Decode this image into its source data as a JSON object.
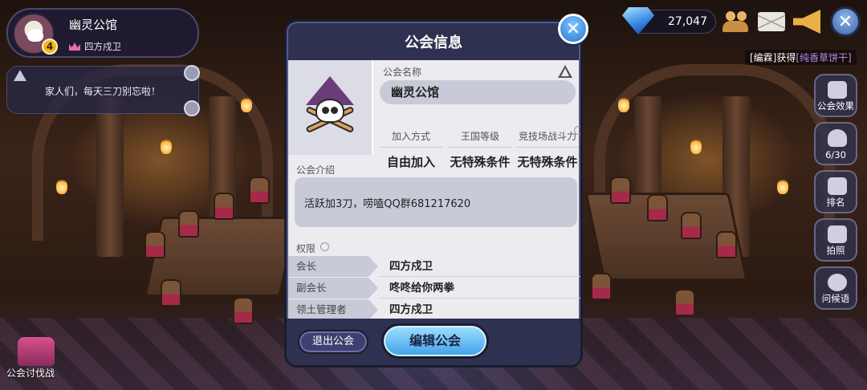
{
  "guild_card": {
    "name": "幽灵公馆",
    "level": "4",
    "leader": "四方戍卫"
  },
  "notice": {
    "text": "家人们，每天三刀别忘啦！"
  },
  "hud": {
    "gems": "27,047",
    "gain_notice": {
      "prefix": "[编霖]获得",
      "item": "[纯香草饼干]"
    }
  },
  "side_buttons": [
    {
      "label": "公会效果",
      "icon": "house-arrow-icon"
    },
    {
      "label": "6/30",
      "icon": "person-icon"
    },
    {
      "label": "排名",
      "icon": "building-icon"
    },
    {
      "label": "拍照",
      "icon": "camera-icon"
    },
    {
      "label": "问候语",
      "icon": "chat-bubble-icon"
    }
  ],
  "guild_war": {
    "label": "公会讨伐战"
  },
  "modal": {
    "title": "公会信息",
    "name_label": "公会名称",
    "name_value": "幽灵公馆",
    "info": [
      {
        "header": "加入方式",
        "value": "自由加入"
      },
      {
        "header": "王国等级",
        "value": "无特殊条件"
      },
      {
        "header": "竞技场战斗力",
        "value": "无特殊条件"
      }
    ],
    "intro_label": "公会介绍",
    "intro_text": "活跃加3刀，唠嗑QQ群681217620",
    "perm_label": "权限",
    "permissions": [
      {
        "role": "会长",
        "holder": "四方戍卫"
      },
      {
        "role": "副会长",
        "holder": "咚咚给你两拳"
      },
      {
        "role": "领土管理者",
        "holder": "四方戍卫"
      }
    ],
    "leave_button": "退出公会",
    "edit_button": "编辑公会"
  }
}
